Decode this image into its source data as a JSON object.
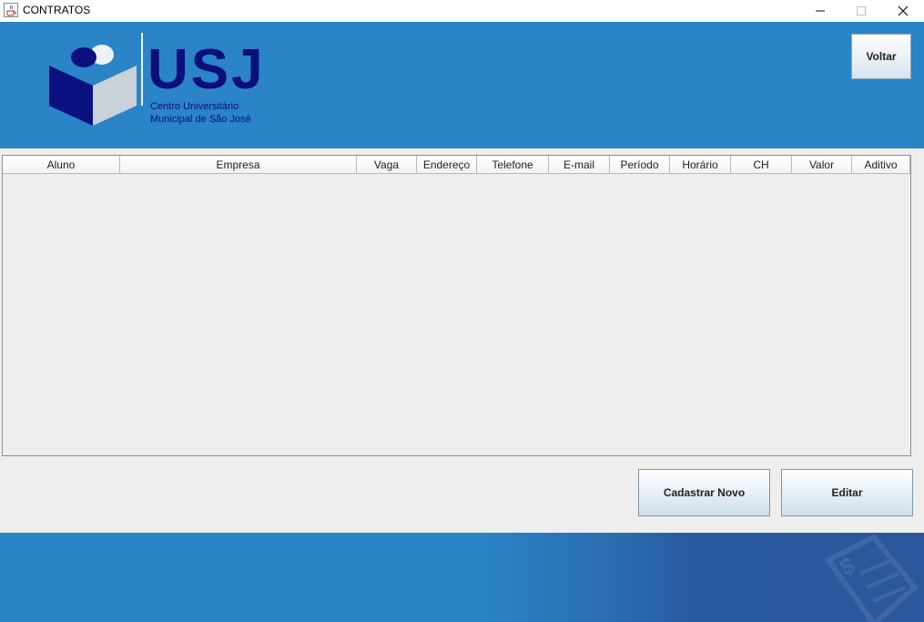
{
  "window": {
    "title": "CONTRATOS",
    "icon": "java-cup-icon",
    "controls": {
      "minimize": "─",
      "maximize": "☐",
      "close": "✕"
    }
  },
  "header": {
    "logo": {
      "brand": "USJ",
      "subtitle_line1": "Centro Universitário",
      "subtitle_line2": "Municipal de São José"
    },
    "back_button_label": "Voltar",
    "background_color": "#2a84c6"
  },
  "table": {
    "columns": [
      "Aluno",
      "Empresa",
      "Vaga",
      "Endereço",
      "Telefone",
      "E-mail",
      "Período",
      "Horário",
      "CH",
      "Valor",
      "Aditivo"
    ],
    "rows": []
  },
  "actions": {
    "create_label": "Cadastrar Novo",
    "edit_label": "Editar"
  },
  "footer": {
    "decoration_icon": "invoice-dollar-icon"
  }
}
